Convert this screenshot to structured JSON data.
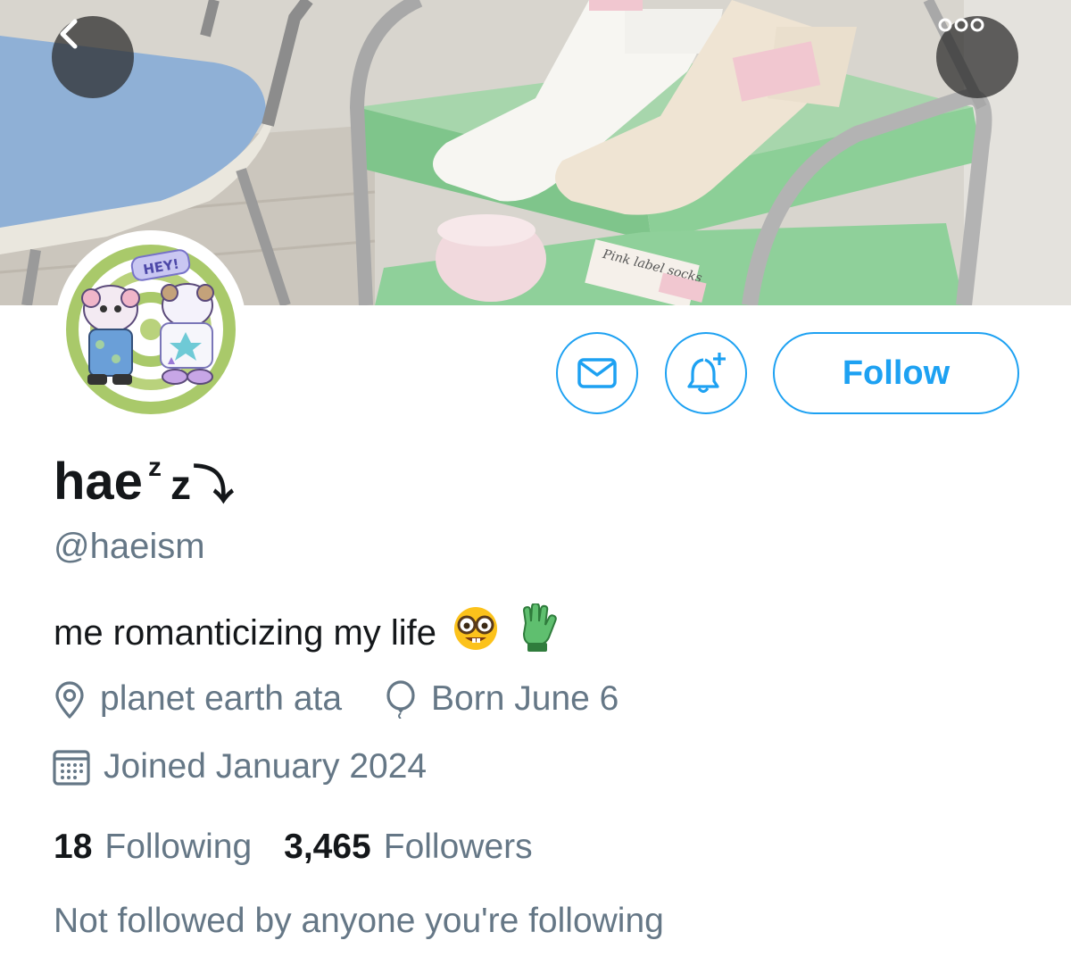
{
  "header": {
    "back_icon": "chevron-left-icon",
    "more_icon": "more-horizontal-icon"
  },
  "banner": {
    "label_text": "Pink label socks"
  },
  "avatar": {
    "sticker_text": "HEY!"
  },
  "actions": {
    "dm_icon": "envelope-icon",
    "notify_icon": "bell-plus-icon",
    "follow_label": "Follow"
  },
  "profile": {
    "display_name": "hae",
    "name_decoration_small": "z",
    "name_decoration_large": "z",
    "name_decoration_arrow": "⤵",
    "handle": "@haeism",
    "bio_text": "me romanticizing my life",
    "bio_emojis": [
      "nerd-face-emoji",
      "green-glove-emoji"
    ],
    "location": "planet earth ata",
    "birthday": "Born June 6",
    "joined": "Joined January 2024"
  },
  "stats": {
    "following_count": "18",
    "following_label": "Following",
    "followers_count": "3,465",
    "followers_label": "Followers"
  },
  "followed_by_text": "Not followed by anyone you're following",
  "colors": {
    "accent": "#1da1f2",
    "secondary_text": "#657786",
    "primary_text": "#14171a"
  }
}
